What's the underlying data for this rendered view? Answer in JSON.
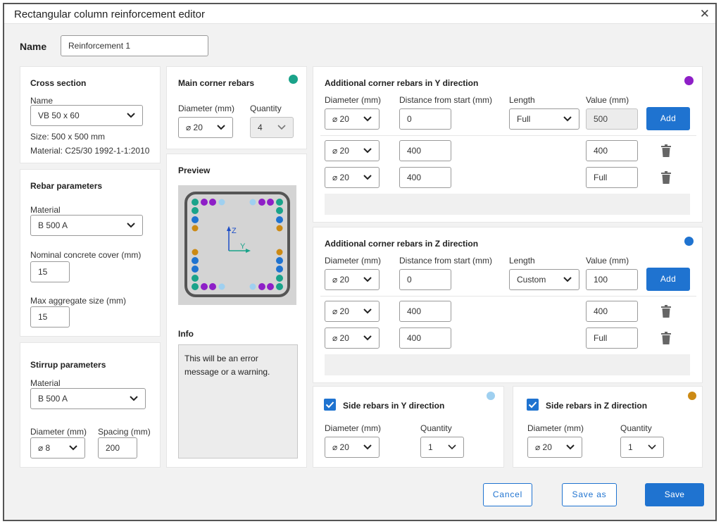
{
  "window": {
    "title": "Rectangular column reinforcement editor"
  },
  "name_field": {
    "label": "Name",
    "value": "Reinforcement 1"
  },
  "cross_section": {
    "heading": "Cross section",
    "name_label": "Name",
    "name_value": "VB 50 x 60",
    "size_text": "Size: 500 x 500 mm",
    "material_text": "Material: C25/30 1992-1-1:2010"
  },
  "rebar_parameters": {
    "heading": "Rebar parameters",
    "material_label": "Material",
    "material_value": "B 500 A",
    "cover_label": "Nominal concrete cover (mm)",
    "cover_value": "15",
    "aggregate_label": "Max aggregate size (mm)",
    "aggregate_value": "15"
  },
  "stirrup_parameters": {
    "heading": "Stirrup parameters",
    "material_label": "Material",
    "material_value": "B 500 A",
    "diameter_label": "Diameter (mm)",
    "diameter_value": "⌀ 8",
    "spacing_label": "Spacing (mm)",
    "spacing_value": "200"
  },
  "main_corner": {
    "heading": "Main corner rebars",
    "color": "#1aa38a",
    "diameter_label": "Diameter (mm)",
    "diameter_value": "⌀ 20",
    "quantity_label": "Quantity",
    "quantity_value": "4"
  },
  "preview": {
    "heading": "Preview",
    "axis_z": "Z",
    "axis_y": "Y"
  },
  "info": {
    "heading": "Info",
    "message": "This will be an error message or a warning."
  },
  "add_y": {
    "heading": "Additional corner rebars in Y direction",
    "color": "#8e1fc7",
    "col_diameter": "Diameter (mm)",
    "col_distance": "Distance from start (mm)",
    "col_length": "Length",
    "col_value": "Value (mm)",
    "new_row": {
      "diameter": "⌀ 20",
      "distance": "0",
      "length": "Full",
      "value": "500"
    },
    "add_label": "Add",
    "rows": [
      {
        "diameter": "⌀ 20",
        "distance": "400",
        "value": "400"
      },
      {
        "diameter": "⌀ 20",
        "distance": "400",
        "value": "Full"
      }
    ]
  },
  "add_z": {
    "heading": "Additional corner rebars in Z direction",
    "color": "#1f73d0",
    "col_diameter": "Diameter (mm)",
    "col_distance": "Distance from start (mm)",
    "col_length": "Length",
    "col_value": "Value (mm)",
    "new_row": {
      "diameter": "⌀ 20",
      "distance": "0",
      "length": "Custom",
      "value": "100"
    },
    "add_label": "Add",
    "rows": [
      {
        "diameter": "⌀ 20",
        "distance": "400",
        "value": "400"
      },
      {
        "diameter": "⌀ 20",
        "distance": "400",
        "value": "Full"
      }
    ]
  },
  "side_y": {
    "heading": "Side rebars in Y direction",
    "color": "#9fd0f0",
    "checked": true,
    "diameter_label": "Diameter (mm)",
    "diameter_value": "⌀ 20",
    "quantity_label": "Quantity",
    "quantity_value": "1"
  },
  "side_z": {
    "heading": "Side rebars in Z direction",
    "color": "#cc8a14",
    "checked": true,
    "diameter_label": "Diameter (mm)",
    "diameter_value": "⌀ 20",
    "quantity_label": "Quantity",
    "quantity_value": "1"
  },
  "footer": {
    "cancel": "Cancel",
    "save_as": "Save as",
    "save": "Save"
  }
}
